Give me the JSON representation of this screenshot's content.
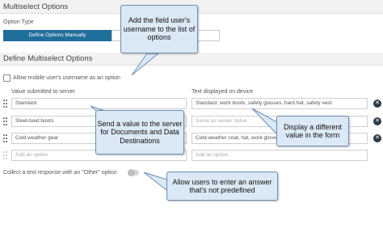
{
  "header": {
    "title": "Multiselect Options"
  },
  "option_type": {
    "label": "Option Type",
    "selected": "Define Options Manually"
  },
  "define_section": {
    "title": "Define Multiselect Options"
  },
  "mobile_username": {
    "label": "Allow mobile user's username as an option",
    "checked": false
  },
  "columns": {
    "value_header": "Value submitted to server",
    "display_header": "Text displayed on device"
  },
  "rows": [
    {
      "value": "Standard",
      "display": "Standard: work boots, safety glasses, hard hat, safety vest",
      "display_is_placeholder": false
    },
    {
      "value": "Steel-toed boots",
      "display": "Same as server Value",
      "display_is_placeholder": true
    },
    {
      "value": "Cold weather gear",
      "display": "Cold-weather coat, hat, work gloves",
      "display_is_placeholder": false
    }
  ],
  "add_row": {
    "value_placeholder": "Add an option",
    "display_placeholder": "Add an option"
  },
  "other_option": {
    "label": "Collect a text response with an \"Other\" option",
    "enabled": false
  },
  "callouts": {
    "username": "Add the field user's username to the list of options",
    "send_value": "Send a value to the server for Documents and Data Destinations",
    "display": "Display a different value in the form",
    "other": "Allow users to enter an answer that's not predefined"
  },
  "colors": {
    "primary": "#1f6e9b",
    "callout_fill": "#dbe8f5",
    "callout_border": "#6f8fb2",
    "remove_icon": "#2d3b47"
  }
}
